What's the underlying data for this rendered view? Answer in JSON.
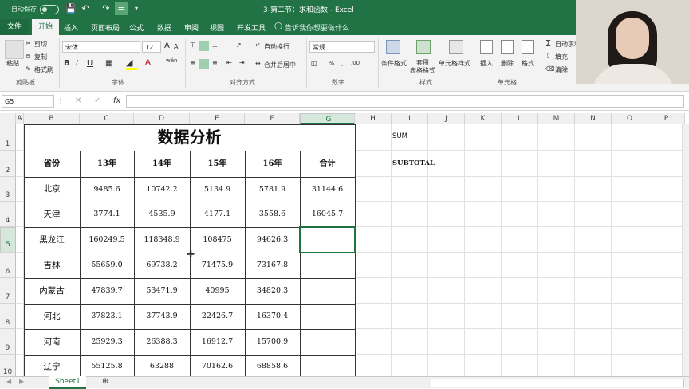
{
  "titlebar": {
    "autosave": "自动保存",
    "autosave_state": "关",
    "title": "3-第二节：求和函数 - Excel"
  },
  "tabs": [
    "文件",
    "开始",
    "插入",
    "页面布局",
    "公式",
    "数据",
    "审阅",
    "视图",
    "开发工具"
  ],
  "tellme": "告诉我你想要做什么",
  "ribbon": {
    "clipboard": {
      "paste": "粘贴",
      "cut": "剪切",
      "copy": "复制",
      "format_painter": "格式刷",
      "label": "剪贴板"
    },
    "font": {
      "name": "宋体",
      "size": "12",
      "bold": "B",
      "italic": "I",
      "underline": "U",
      "grow": "A",
      "shrink": "A",
      "label": "字体",
      "wen": "wén",
      "color_a": "A"
    },
    "align": {
      "wrap": "自动换行",
      "merge": "合并后居中",
      "label": "对齐方式"
    },
    "number": {
      "format": "常规",
      "pct": "%",
      "comma": ",",
      "label": "数字",
      "inc_dec": ".00"
    },
    "styles": {
      "cond": "条件格式",
      "table": "套用\n表格格式",
      "cell": "单元格样式",
      "label": "样式"
    },
    "cells": {
      "insert": "插入",
      "delete": "删除",
      "format": "格式",
      "label": "单元格"
    },
    "editing": {
      "autosum": "自动求和",
      "fill": "填充",
      "clear": "清除"
    }
  },
  "namebox": "G5",
  "formula": "",
  "fx": "fx",
  "columns": [
    "A",
    "B",
    "C",
    "D",
    "E",
    "F",
    "G",
    "H",
    "I",
    "J",
    "K",
    "L",
    "M",
    "N",
    "O",
    "P"
  ],
  "rows": [
    "1",
    "2",
    "3",
    "4",
    "5",
    "6",
    "7",
    "8",
    "9",
    "10"
  ],
  "sheet": {
    "title": "数据分析",
    "headers": [
      "省份",
      "13年",
      "14年",
      "15年",
      "16年",
      "合计"
    ],
    "data": [
      [
        "北京",
        "9485.6",
        "10742.2",
        "5134.9",
        "5781.9",
        "31144.6"
      ],
      [
        "天津",
        "3774.1",
        "4535.9",
        "4177.1",
        "3558.6",
        "16045.7"
      ],
      [
        "黑龙江",
        "160249.5",
        "118348.9",
        "108475",
        "94626.3",
        ""
      ],
      [
        "吉林",
        "55659.0",
        "69738.2",
        "71475.9",
        "73167.8",
        ""
      ],
      [
        "内蒙古",
        "47839.7",
        "53471.9",
        "40995",
        "34820.3",
        ""
      ],
      [
        "河北",
        "37823.1",
        "37743.9",
        "22426.7",
        "16370.4",
        ""
      ],
      [
        "河南",
        "25929.3",
        "26388.3",
        "16912.7",
        "15700.9",
        ""
      ],
      [
        "辽宁",
        "55125.8",
        "63288",
        "70162.6",
        "68858.6",
        ""
      ]
    ],
    "notes": {
      "sum": "SUM",
      "subtotal": "SUBTOTAL"
    }
  },
  "sheet_tab": "Sheet1",
  "colors": {
    "accent": "#217346"
  }
}
